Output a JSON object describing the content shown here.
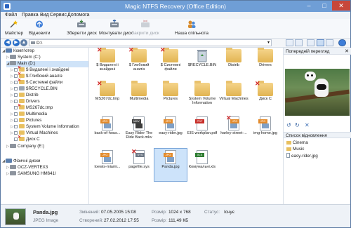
{
  "app": {
    "title": "Magic NTFS Recovery (Office Edition)"
  },
  "window": {
    "minimize": "–",
    "maximize": "□",
    "close": "✕"
  },
  "menu": [
    "Файл",
    "Правка",
    "Вид",
    "Сервис",
    "Допомога"
  ],
  "toolbar": {
    "wizard": "Майстер",
    "restore": "Відновити",
    "save_disk": "Зберегти диск",
    "mount_disk": "Монтувати диск",
    "close_disk": "Закрити диск",
    "community": "Наша спільнота"
  },
  "address": {
    "path": "D:\\"
  },
  "tree": [
    {
      "label": "Комп'ютер"
    },
    {
      "label": "System (C:)"
    },
    {
      "label": "Main (D:)"
    },
    {
      "label": "$ Видалені і знайдені"
    },
    {
      "label": "$ Глибокий аналіз"
    },
    {
      "label": "$ Системні файли"
    },
    {
      "label": "$RECYCLE.BIN"
    },
    {
      "label": "Distrib"
    },
    {
      "label": "Drivers"
    },
    {
      "label": "MS267dc.tmp"
    },
    {
      "label": "Multimedia"
    },
    {
      "label": "Pictures"
    },
    {
      "label": "System Volume Information"
    },
    {
      "label": "Virtual Machines"
    },
    {
      "label": "Диск C"
    },
    {
      "label": "Company (E:)"
    },
    {
      "label": "Фізичні диски"
    },
    {
      "label": "OCZ-VERTEX3"
    },
    {
      "label": "SAMSUNG HM641I"
    }
  ],
  "files": [
    {
      "name": "$ Видалені і знайдені",
      "kind": "folder",
      "deleted": true
    },
    {
      "name": "$ Глибокий аналіз",
      "kind": "folder",
      "deleted": true
    },
    {
      "name": "$ Системні файли",
      "kind": "folder",
      "deleted": true
    },
    {
      "name": "$RECYCLE.BIN",
      "kind": "bin"
    },
    {
      "name": "Distrib",
      "kind": "folder"
    },
    {
      "name": "Drivers",
      "kind": "folder"
    },
    {
      "name": "MS267dc.tmp",
      "kind": "folder",
      "deleted": true
    },
    {
      "name": "Multimedia",
      "kind": "folder"
    },
    {
      "name": "Pictures",
      "kind": "folder"
    },
    {
      "name": "System Volume Information",
      "kind": "folder"
    },
    {
      "name": "Virtual Machines",
      "kind": "folder"
    },
    {
      "name": "Диск C",
      "kind": "folder",
      "deleted": true
    },
    {
      "name": "back-of-hous...",
      "kind": "jpg",
      "tag": "JPG"
    },
    {
      "name": "Easy Rider The Ride Back.mkv",
      "kind": "mkv",
      "tag": "MKV"
    },
    {
      "name": "easy-rider.jpg",
      "kind": "jpg",
      "tag": "JPG"
    },
    {
      "name": "EIS workplan.pdf",
      "kind": "pdf",
      "tag": "PDF"
    },
    {
      "name": "harley-street-...",
      "kind": "jpg",
      "tag": "JPG",
      "deleted": true
    },
    {
      "name": "img-home.jpg",
      "kind": "jpg",
      "tag": "JPG"
    },
    {
      "name": "loewis-miami...",
      "kind": "jpg",
      "tag": "JPG"
    },
    {
      "name": "pagefile.sys",
      "kind": "sys",
      "tag": "SYS",
      "deleted": true
    },
    {
      "name": "Panda.jpg",
      "kind": "jpg",
      "tag": "JPG",
      "selected": true
    },
    {
      "name": "Комунальні.xls",
      "kind": "xls",
      "tag": "XLS"
    }
  ],
  "right_pane": {
    "preview_title": "Попередній перегляд",
    "close": "✕",
    "rotate_left": "↺",
    "rotate_right": "↻",
    "recovery_title": "Список відновлення",
    "recovery_items": [
      "Cinema",
      "Music",
      "easy-rider.jpg"
    ]
  },
  "status": {
    "filename": "Panda.jpg",
    "filetype": "JPEG Image",
    "modified_label": "Змінений:",
    "modified_value": "07.05.2005 15:08",
    "created_label": "Створений:",
    "created_value": "27.02.2012 17:55",
    "size_label": "Розмір:",
    "size_value": "1024 x 768",
    "filesize_label": "Розмір:",
    "filesize_value": "111,49 КБ",
    "state_label": "Статус:",
    "state_value": "Існує"
  },
  "colors": {
    "accent": "#6f9ed6",
    "selection": "#cde3fa",
    "deleted_mark": "#d22b2b"
  }
}
